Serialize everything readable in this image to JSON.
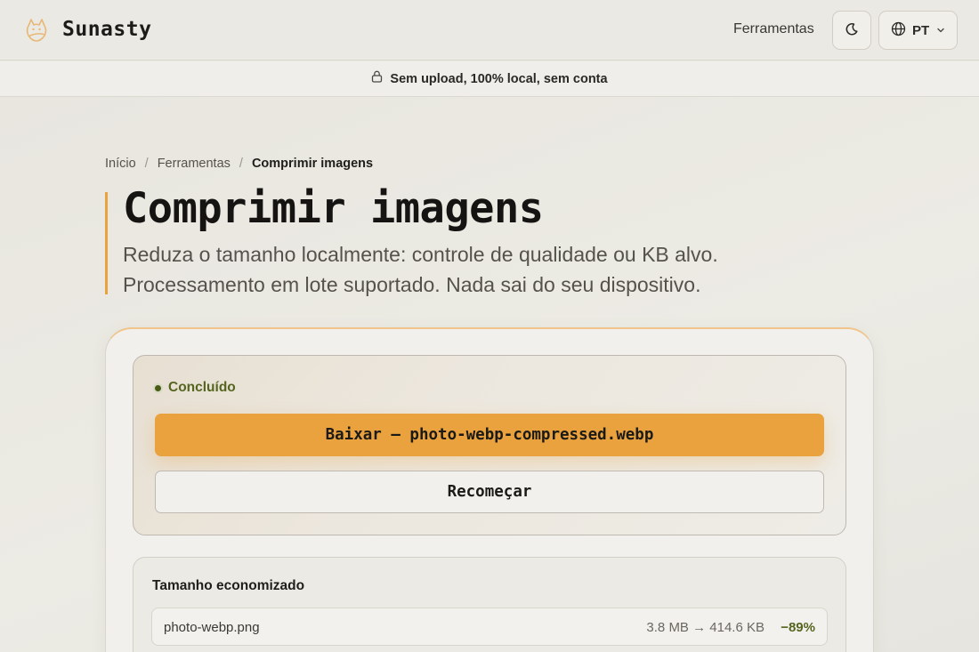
{
  "header": {
    "brand": "Sunasty",
    "nav_tools": "Ferramentas",
    "theme_icon": "moon-icon",
    "language": "PT"
  },
  "privacy_strip": {
    "text": "Sem upload, 100% local, sem conta",
    "icon": "lock-icon"
  },
  "breadcrumb": {
    "items": [
      "Início",
      "Ferramentas",
      "Comprimir imagens"
    ]
  },
  "page": {
    "title": "Comprimir imagens",
    "subtitle": "Reduza o tamanho localmente: controle de qualidade ou KB alvo. Processamento em lote suportado. Nada sai do seu dispositivo."
  },
  "result": {
    "status": "Concluído",
    "download_label": "Baixar — photo-webp-compressed.webp",
    "restart_label": "Recomeçar"
  },
  "savings": {
    "title": "Tamanho economizado",
    "files": [
      {
        "name": "photo-webp.png",
        "sizes": "3.8 MB → 414.6 KB",
        "percent": "−89%"
      }
    ]
  },
  "colors": {
    "accent": "#e9a23d",
    "success": "#55651f",
    "background": "#e9e7e1"
  }
}
